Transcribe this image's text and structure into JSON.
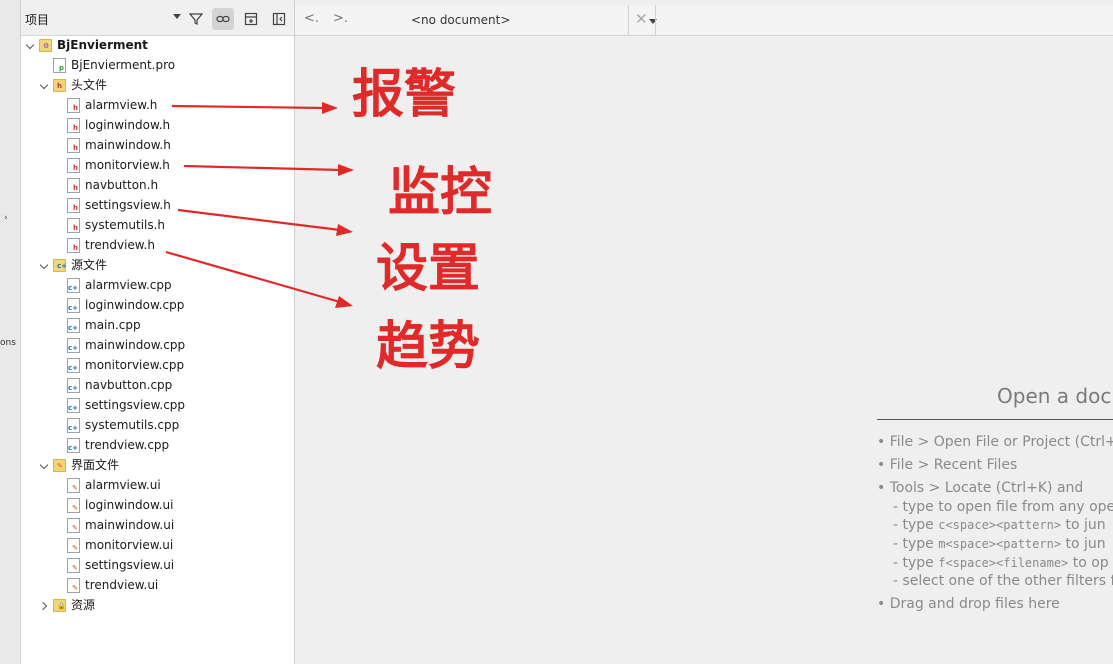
{
  "project_pane": {
    "selector_label": "项目",
    "tool_icons": [
      "filter-icon",
      "link-icon",
      "add-split-icon",
      "close-split-icon"
    ]
  },
  "tree": [
    {
      "level": 0,
      "expand": "down",
      "icon": "project",
      "label": "BjEnvierment",
      "bold": true
    },
    {
      "level": 1,
      "expand": "none",
      "icon": "pro",
      "label": "BjEnvierment.pro"
    },
    {
      "level": 1,
      "expand": "down",
      "icon": "folder-h",
      "label": "头文件"
    },
    {
      "level": 2,
      "expand": "none",
      "icon": "h",
      "label": "alarmview.h"
    },
    {
      "level": 2,
      "expand": "none",
      "icon": "h",
      "label": "loginwindow.h"
    },
    {
      "level": 2,
      "expand": "none",
      "icon": "h",
      "label": "mainwindow.h"
    },
    {
      "level": 2,
      "expand": "none",
      "icon": "h",
      "label": "monitorview.h"
    },
    {
      "level": 2,
      "expand": "none",
      "icon": "h",
      "label": "navbutton.h"
    },
    {
      "level": 2,
      "expand": "none",
      "icon": "h",
      "label": "settingsview.h"
    },
    {
      "level": 2,
      "expand": "none",
      "icon": "h",
      "label": "systemutils.h"
    },
    {
      "level": 2,
      "expand": "none",
      "icon": "h",
      "label": "trendview.h"
    },
    {
      "level": 1,
      "expand": "down",
      "icon": "folder-cpp",
      "label": "源文件"
    },
    {
      "level": 2,
      "expand": "none",
      "icon": "cpp",
      "label": "alarmview.cpp"
    },
    {
      "level": 2,
      "expand": "none",
      "icon": "cpp",
      "label": "loginwindow.cpp"
    },
    {
      "level": 2,
      "expand": "none",
      "icon": "cpp",
      "label": "main.cpp"
    },
    {
      "level": 2,
      "expand": "none",
      "icon": "cpp",
      "label": "mainwindow.cpp"
    },
    {
      "level": 2,
      "expand": "none",
      "icon": "cpp",
      "label": "monitorview.cpp"
    },
    {
      "level": 2,
      "expand": "none",
      "icon": "cpp",
      "label": "navbutton.cpp"
    },
    {
      "level": 2,
      "expand": "none",
      "icon": "cpp",
      "label": "settingsview.cpp"
    },
    {
      "level": 2,
      "expand": "none",
      "icon": "cpp",
      "label": "systemutils.cpp"
    },
    {
      "level": 2,
      "expand": "none",
      "icon": "cpp",
      "label": "trendview.cpp"
    },
    {
      "level": 1,
      "expand": "down",
      "icon": "folder-ui",
      "label": "界面文件"
    },
    {
      "level": 2,
      "expand": "none",
      "icon": "ui",
      "label": "alarmview.ui"
    },
    {
      "level": 2,
      "expand": "none",
      "icon": "ui",
      "label": "loginwindow.ui"
    },
    {
      "level": 2,
      "expand": "none",
      "icon": "ui",
      "label": "mainwindow.ui"
    },
    {
      "level": 2,
      "expand": "none",
      "icon": "ui",
      "label": "monitorview.ui"
    },
    {
      "level": 2,
      "expand": "none",
      "icon": "ui",
      "label": "settingsview.ui"
    },
    {
      "level": 2,
      "expand": "none",
      "icon": "ui",
      "label": "trendview.ui"
    },
    {
      "level": 1,
      "expand": "right",
      "icon": "folder-res",
      "label": "资源"
    }
  ],
  "left_rail": {
    "text": "ons"
  },
  "editor_bar": {
    "back": "<.",
    "forward": ">.",
    "document": "<no document>",
    "close": "✕"
  },
  "welcome": {
    "title": "Open a docu",
    "line1": "• File > Open File or Project (Ctrl+O",
    "line2": "• File > Recent Files",
    "line3": "• Tools > Locate (Ctrl+K) and",
    "sub1": "- type to open file from any oper",
    "sub2_pre": "- type ",
    "sub2_code": "c<space><pattern>",
    "sub2_post": " to jun",
    "sub3_pre": "- type ",
    "sub3_code": "m<space><pattern>",
    "sub3_post": " to jun",
    "sub4_pre": "- type ",
    "sub4_code": "f<space><filename>",
    "sub4_post": " to op",
    "sub5": "- select one of the other filters fo",
    "line4": "• Drag and drop files here"
  },
  "annotations": [
    "报警",
    "监控",
    "设置",
    "趋势"
  ],
  "colors": {
    "annotation": "#e02a2a",
    "folder": "#f4d67a",
    "h_tag": "#c0392b",
    "cpp_tag": "#1f6fb5",
    "ui_tag": "#d35400",
    "pro_tag": "#3a9a3a"
  }
}
